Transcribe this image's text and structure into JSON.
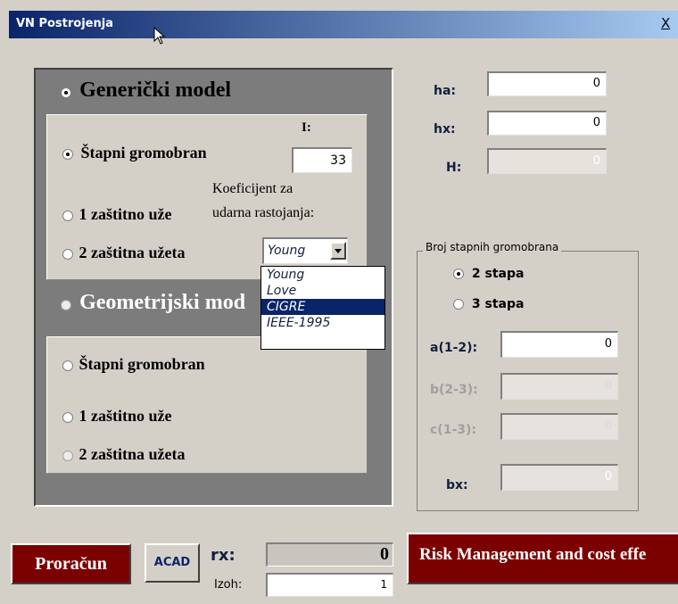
{
  "window": {
    "title": "VN Postrojenja",
    "close": "X"
  },
  "generic": {
    "heading": "Generički model",
    "options": [
      "Štapni gromobran",
      "1 zaštitno uže",
      "2 zaštitna užeta"
    ],
    "i_label": "I:",
    "i_value": "33",
    "coef_label_1": "Koeficijent za",
    "coef_label_2": "udarna rastojanja:",
    "select_value": "Young",
    "select_options": [
      "Young",
      "Love",
      "CIGRE",
      "IEEE-1995"
    ],
    "selected_option": "CIGRE"
  },
  "geometric": {
    "heading": "Geometrijski mod",
    "options": [
      "Štapni gromobran",
      "1 zaštitno uže",
      "2 zaštitna užeta"
    ]
  },
  "fields": {
    "ha_label": "ha:",
    "ha_value": "0",
    "hx_label": "hx:",
    "hx_value": "0",
    "H_label": "H:",
    "H_value": "0"
  },
  "stap_group": {
    "legend": "Broj stapnih gromobrana",
    "opt1": "2 stapa",
    "opt2": "3 stapa",
    "a_label": "a(1-2):",
    "a_value": "0",
    "b_label": "b(2-3):",
    "b_value": "0",
    "c_label": "c(1-3):",
    "c_value": "0",
    "bx_label": "bx:",
    "bx_value": "0"
  },
  "bottom": {
    "proracun": "Proračun",
    "acad": "ACAD",
    "rx_label": "rx:",
    "rx_value": "0",
    "izoh_label": "Izoh:",
    "izoh_value": "1",
    "risk_button": "Risk Management and cost effe"
  }
}
